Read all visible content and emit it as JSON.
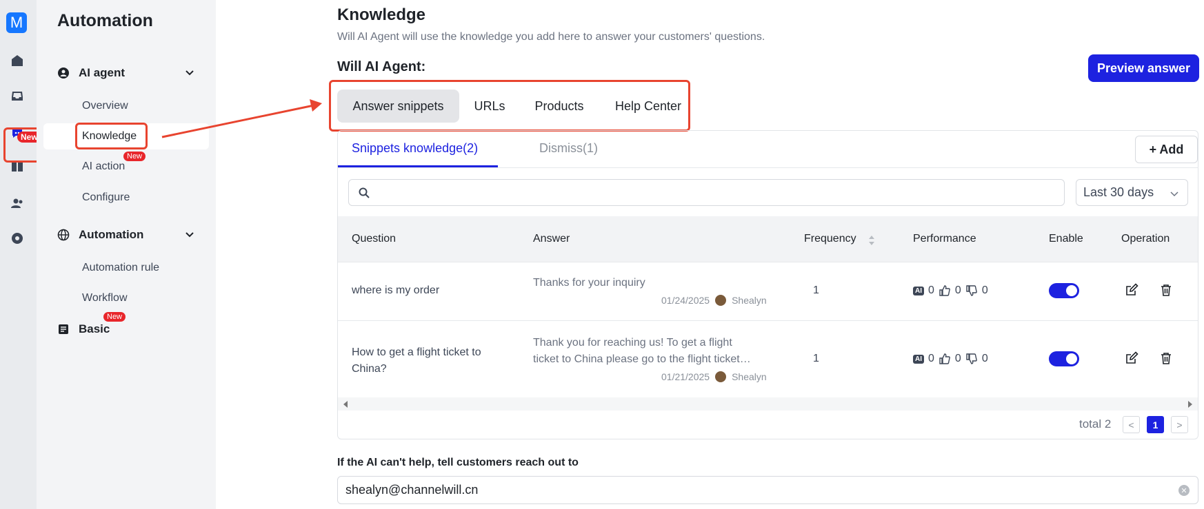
{
  "rail": {
    "logo": "M",
    "items": [
      "home-icon",
      "inbox-icon",
      "ai-agent-icon",
      "book-icon",
      "users-icon",
      "analytics-icon"
    ],
    "badge": "New"
  },
  "sidebar": {
    "title": "Automation",
    "groups": [
      {
        "label": "AI agent",
        "items": [
          "Overview",
          "Knowledge",
          "AI action",
          "Configure"
        ]
      },
      {
        "label": "Automation",
        "items": [
          "Automation rule",
          "Workflow"
        ]
      },
      {
        "label": "Basic",
        "items": []
      }
    ],
    "new_badge": "New"
  },
  "main": {
    "title": "Knowledge",
    "description": "Will AI Agent will use the knowledge you add here to answer your customers' questions.",
    "agent_label": "Will AI Agent:",
    "preview_button": "Preview answer",
    "segments": [
      "Answer snippets",
      "URLs",
      "Products",
      "Help Center"
    ],
    "tabs": [
      "Snippets knowledge(2)",
      "Dismiss(1)"
    ],
    "add_button": "+ Add",
    "date_range": "Last 30 days",
    "columns": [
      "Question",
      "Answer",
      "Frequency",
      "Performance",
      "Enable",
      "Operation"
    ],
    "rows": [
      {
        "question": "where is my order",
        "answer_line1": "Thanks for your inquiry",
        "answer_line2": "",
        "date": "01/24/2025",
        "author": "Shealyn",
        "frequency": "1",
        "ai": "0",
        "up": "0",
        "down": "0"
      },
      {
        "question_line1": "How to get a flight ticket to",
        "question_line2": "China?",
        "answer_line1": "Thank you for reaching us! To get a flight",
        "answer_line2": "ticket to China please go to the flight ticket…",
        "date": "01/21/2025",
        "author": "Shealyn",
        "frequency": "1",
        "ai": "0",
        "up": "0",
        "down": "0"
      }
    ],
    "pager": {
      "total": "total 2",
      "current": "1",
      "prev": "<",
      "next": ">"
    },
    "fallback_label": "If the AI can't help, tell customers reach out to",
    "fallback_email": "shealyn@channelwill.cn",
    "ai_badge": "AI"
  },
  "colors": {
    "accent": "#1d22e0",
    "highlight": "#e8442f",
    "badge": "#e8262b"
  }
}
